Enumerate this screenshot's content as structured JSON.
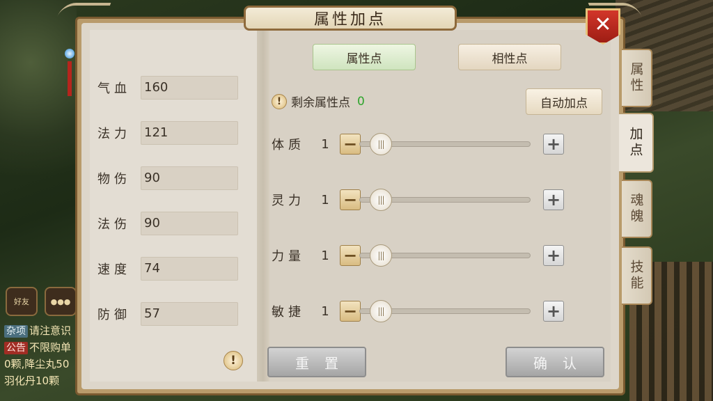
{
  "title": "属性加点",
  "close_label": "✕",
  "stats": [
    {
      "label": "气血",
      "value": "160"
    },
    {
      "label": "法力",
      "value": "121"
    },
    {
      "label": "物伤",
      "value": "90"
    },
    {
      "label": "法伤",
      "value": "90"
    },
    {
      "label": "速度",
      "value": "74"
    },
    {
      "label": "防御",
      "value": "57"
    }
  ],
  "tabs": [
    {
      "label": "属性点",
      "active": true
    },
    {
      "label": "相性点",
      "active": false
    }
  ],
  "remaining": {
    "label": "剩余属性点",
    "value": "0"
  },
  "auto_button": "自动加点",
  "sliders": [
    {
      "label": "体质",
      "value": "1"
    },
    {
      "label": "灵力",
      "value": "1"
    },
    {
      "label": "力量",
      "value": "1"
    },
    {
      "label": "敏捷",
      "value": "1"
    }
  ],
  "reset_button": "重置",
  "confirm_button": "确认",
  "side_tabs": [
    {
      "label": "属性",
      "active": false
    },
    {
      "label": "加点",
      "active": true
    },
    {
      "label": "魂魄",
      "active": false
    },
    {
      "label": "技能",
      "active": false
    }
  ],
  "social": {
    "friends_label": "好友"
  },
  "chat": [
    {
      "tag": "杂项",
      "text": "请注意识"
    },
    {
      "tag": "公告",
      "text": "不限购单"
    },
    {
      "tag": "",
      "text": "0颗,降尘丸50"
    },
    {
      "tag": "",
      "text": "羽化丹10颗"
    }
  ],
  "colors": {
    "accent_green": "#2ea52d",
    "close_red": "#c42d22"
  }
}
